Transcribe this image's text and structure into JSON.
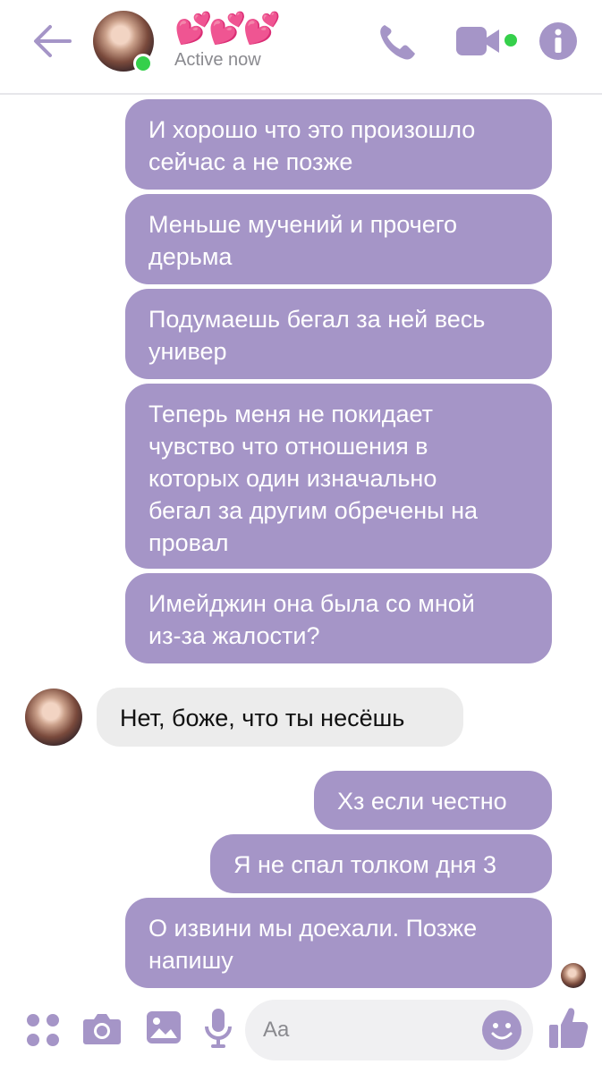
{
  "header": {
    "title": "💕💕💕",
    "status": "Active now",
    "icons": [
      "back-arrow-icon",
      "phone-icon",
      "video-camera-icon",
      "info-icon"
    ]
  },
  "colors": {
    "accent": "#a595c7",
    "outgoing_bubble": "#a595c7",
    "incoming_bubble": "#ececec",
    "online": "#35d04b"
  },
  "messages": [
    {
      "direction": "outgoing",
      "text": "И хорошо что это произошло\nсейчас а не позже"
    },
    {
      "direction": "outgoing",
      "text": "Меньше мучений и прочего\nдерьма"
    },
    {
      "direction": "outgoing",
      "text": "Подумаешь бегал за ней весь\nунивер"
    },
    {
      "direction": "outgoing",
      "text": "Теперь меня не покидает\nчувство что отношения в\nкоторых один изначально\nбегал за другим обречены на\nпровал"
    },
    {
      "direction": "outgoing",
      "text": "Имейджин она была со мной\nиз-за жалости?"
    },
    {
      "direction": "incoming",
      "text": "Нет, боже, что ты несёшь"
    },
    {
      "direction": "outgoing",
      "text": "Хз если честно"
    },
    {
      "direction": "outgoing",
      "text": "Я не спал толком дня 3"
    },
    {
      "direction": "outgoing",
      "text": "О извини мы доехали. Позже\nнапишу"
    }
  ],
  "composer": {
    "placeholder": "Aa",
    "icons": [
      "apps-grid-icon",
      "camera-icon",
      "image-icon",
      "microphone-icon",
      "emoji-icon",
      "thumbs-up-icon"
    ]
  }
}
